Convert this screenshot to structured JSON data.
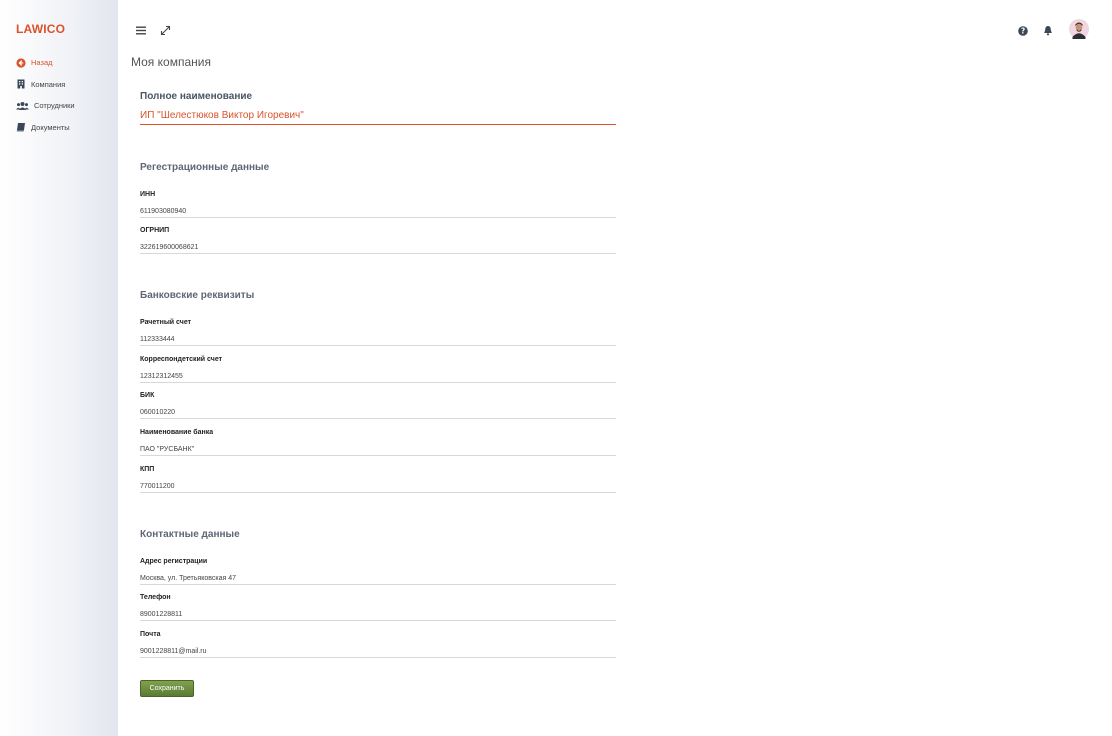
{
  "app": {
    "logo": "LAWICO"
  },
  "sidebar": {
    "items": [
      {
        "label": "Назад",
        "icon": "arrow-left-circle-icon"
      },
      {
        "label": "Компания",
        "icon": "building-icon"
      },
      {
        "label": "Сотрудники",
        "icon": "users-icon"
      },
      {
        "label": "Документы",
        "icon": "book-icon"
      }
    ]
  },
  "topbar": {
    "icons": [
      "menu-icon",
      "expand-icon",
      "help-icon",
      "bell-icon",
      "avatar"
    ]
  },
  "page": {
    "title": "Моя компания"
  },
  "company": {
    "fullname_label": "Полное наименование",
    "fullname_value": "ИП \"Шелестюков Виктор Игоревич\""
  },
  "registration": {
    "title": "Регестрационные данные",
    "fields": [
      {
        "label": "ИНН",
        "value": "611903080940"
      },
      {
        "label": "ОГРНИП",
        "value": "322619600068621"
      }
    ]
  },
  "bank": {
    "title": "Банковские реквизиты",
    "fields": [
      {
        "label": "Рачетный счет",
        "value": "112333444"
      },
      {
        "label": "Корреспондетский счет",
        "value": "12312312455"
      },
      {
        "label": "БИК",
        "value": "060010220"
      },
      {
        "label": "Наименование банка",
        "value": "ПАО \"РУСБАНК\""
      },
      {
        "label": "КПП",
        "value": "770011200"
      }
    ]
  },
  "contacts": {
    "title": "Контактные данные",
    "fields": [
      {
        "label": "Адрес регистрации",
        "value": "Москва, ул. Третьяковская 47"
      },
      {
        "label": "Телефон",
        "value": "89001228811"
      },
      {
        "label": "Почта",
        "value": "9001228811@mail.ru"
      }
    ]
  },
  "actions": {
    "save_label": "Сохранить"
  },
  "colors": {
    "accent": "#d9532c",
    "button": "#6b8c3f"
  }
}
